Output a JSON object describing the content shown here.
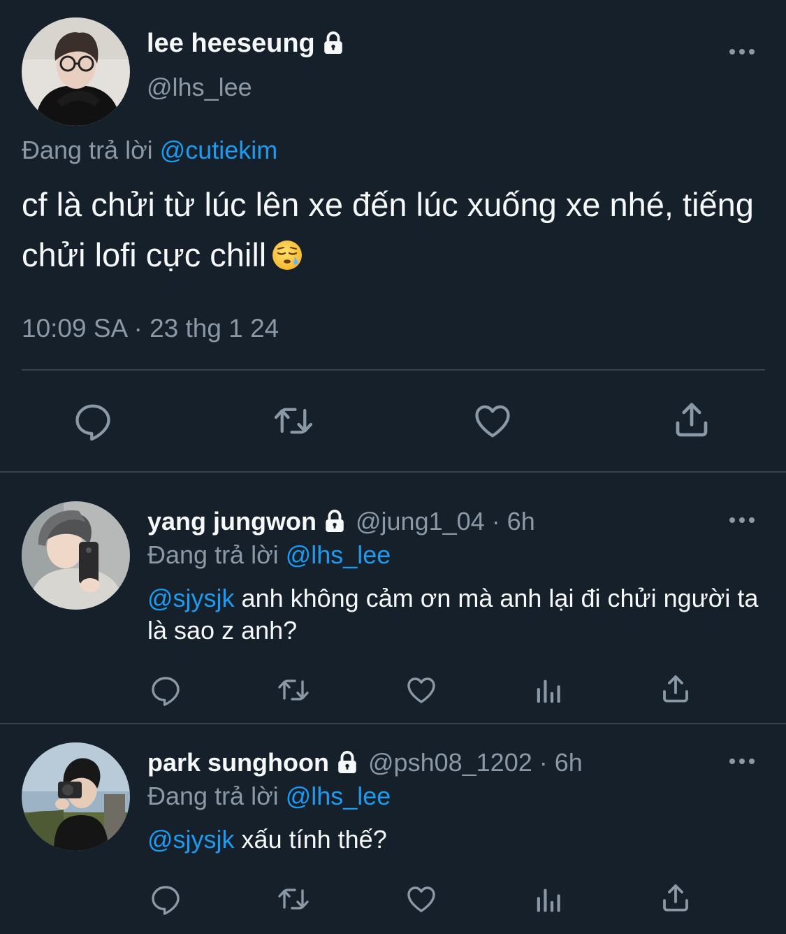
{
  "main_tweet": {
    "display_name": "lee heeseung",
    "handle": "@lhs_lee",
    "replying_prefix": "Đang trả lời",
    "replying_to": "@cutiekim",
    "text": "cf là chửi từ lúc lên xe đến lúc xuống xe nhé, tiếng chửi lofi cực chill",
    "emoji": "sleepy-face-emoji",
    "timestamp": "10:09 SA · 23 thg 1 24",
    "actions": [
      "reply-icon",
      "retweet-icon",
      "like-icon",
      "share-icon"
    ]
  },
  "replies": [
    {
      "display_name": "yang jungwon",
      "handle": "@jung1_04",
      "time": "· 6h",
      "replying_prefix": "Đang trả lời",
      "replying_to": "@lhs_lee",
      "mention": "@sjysjk",
      "text": " anh không cảm ơn mà anh lại đi chửi người ta là sao z anh?",
      "actions": [
        "reply-icon",
        "retweet-icon",
        "like-icon",
        "views-icon",
        "share-icon"
      ]
    },
    {
      "display_name": "park sunghoon",
      "handle": "@psh08_1202",
      "time": "· 6h",
      "replying_prefix": "Đang trả lời",
      "replying_to": "@lhs_lee",
      "mention": "@sjysjk",
      "text": " xấu tính thế?",
      "actions": [
        "reply-icon",
        "retweet-icon",
        "like-icon",
        "views-icon",
        "share-icon"
      ]
    }
  ],
  "colors": {
    "background": "#15202b",
    "text": "#f7f9f9",
    "secondary": "#8b98a5",
    "accent": "#1d9bf0",
    "divider": "#38444d"
  }
}
